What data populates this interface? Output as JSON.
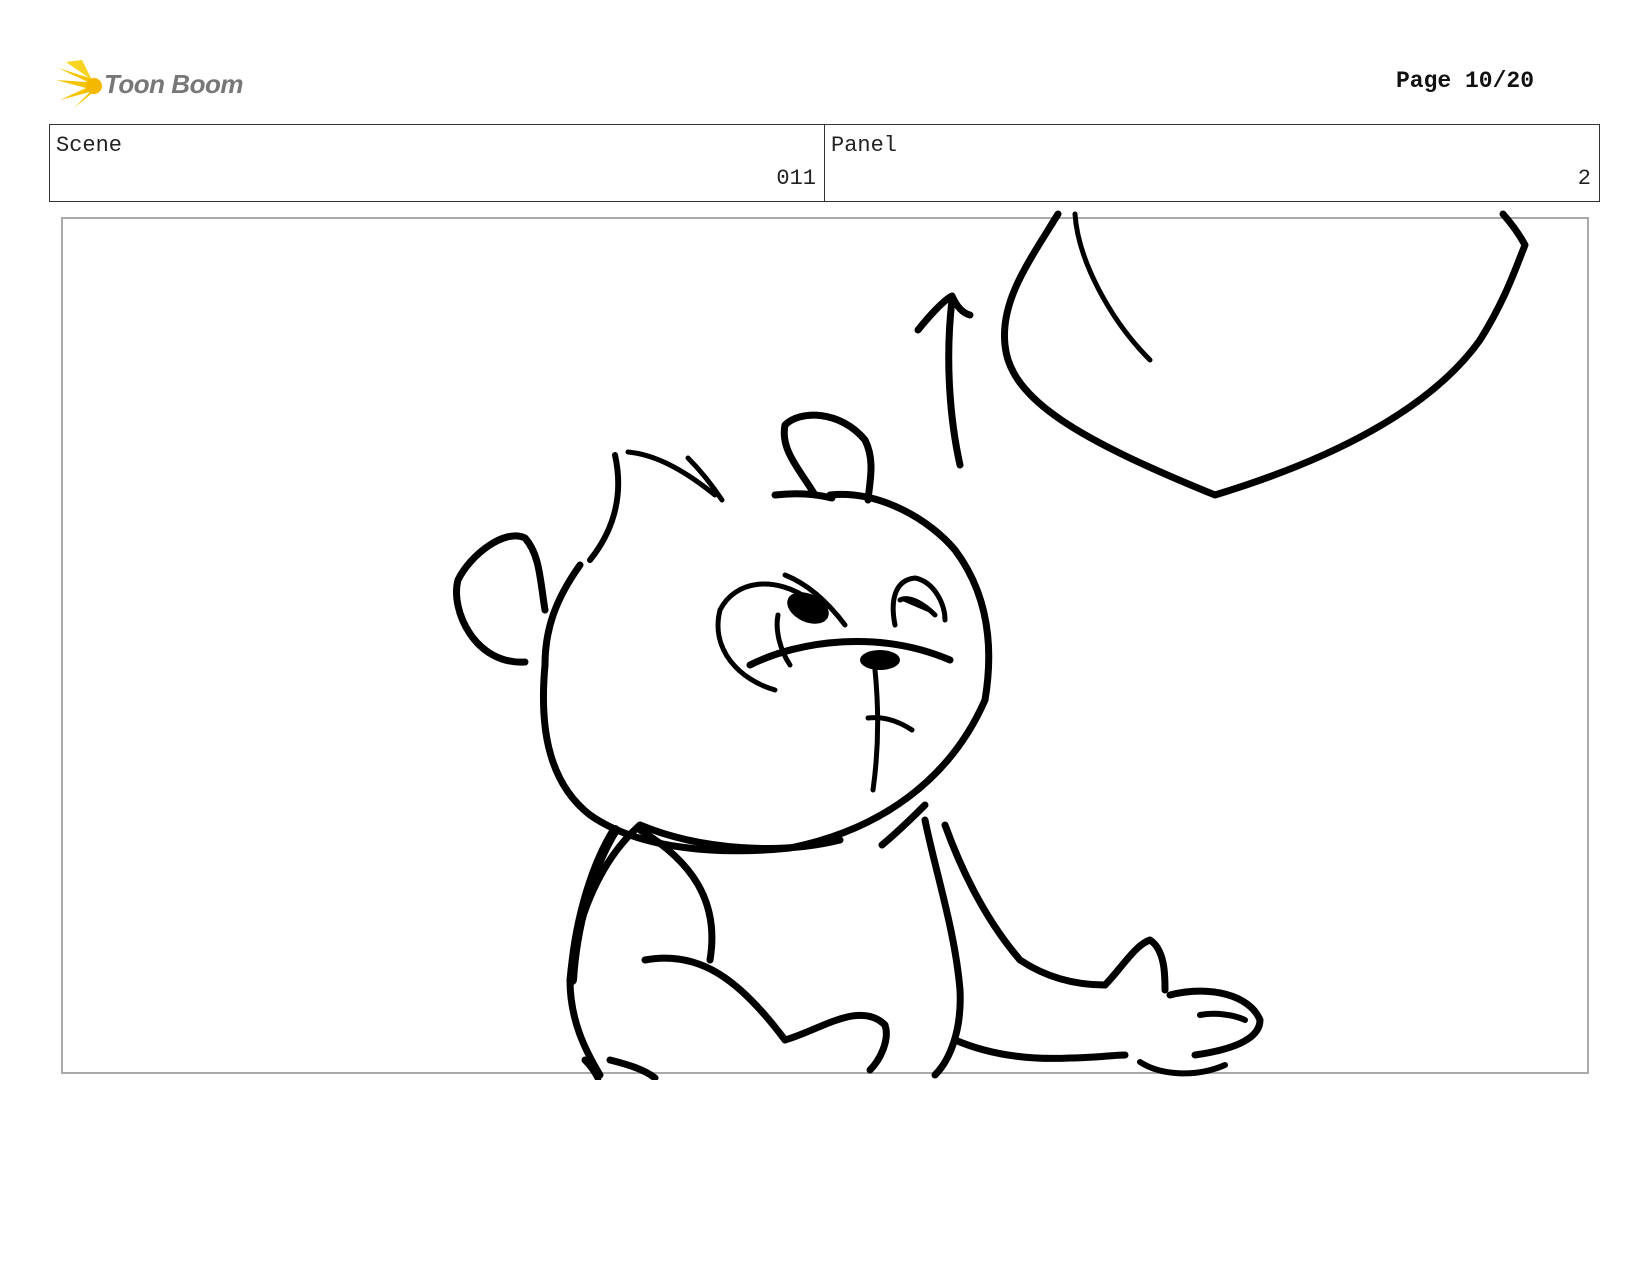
{
  "header": {
    "logo_text": "Toon Boom",
    "page_label": "Page 10/20"
  },
  "info": {
    "scene_label": "Scene",
    "scene_value": "011",
    "panel_label": "Panel",
    "panel_value": "2"
  },
  "panel_image": {
    "subject": "bear-cub-sketch-looking-up",
    "elements": [
      "bear-cub",
      "up-arrow",
      "object-above"
    ]
  }
}
